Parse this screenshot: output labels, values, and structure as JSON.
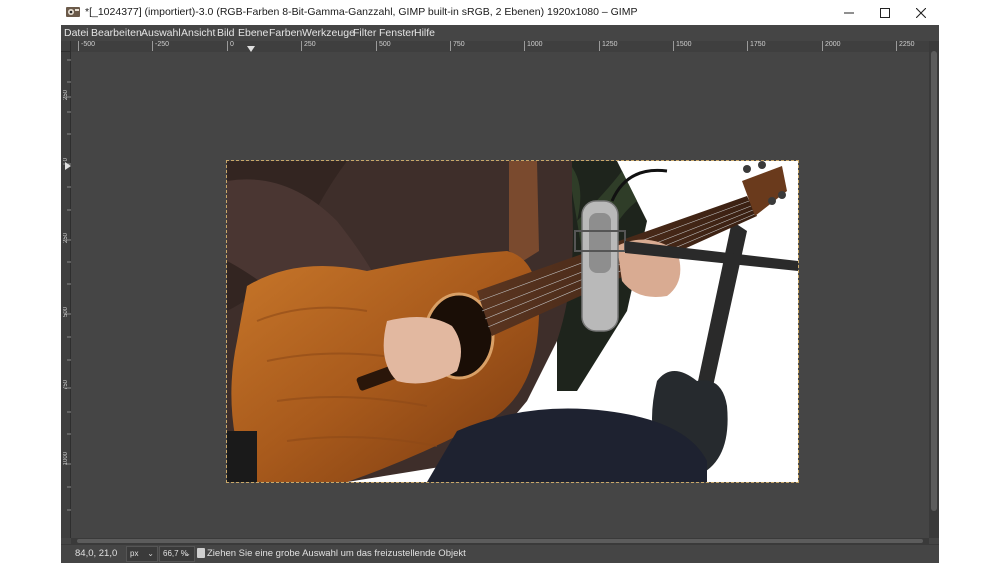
{
  "window": {
    "title": "*[_1024377] (importiert)-3.0 (RGB-Farben 8-Bit-Gamma-Ganzzahl, GIMP built-in sRGB, 2 Ebenen) 1920x1080 – GIMP",
    "controls": {
      "minimize": "—",
      "maximize": "☐",
      "close": "✕"
    }
  },
  "menu": [
    {
      "label": "Datei"
    },
    {
      "label": "Bearbeiten"
    },
    {
      "label": "Auswahl"
    },
    {
      "label": "Ansicht"
    },
    {
      "label": "Bild"
    },
    {
      "label": "Ebene"
    },
    {
      "label": "Farben"
    },
    {
      "label": "Werkzeuge"
    },
    {
      "label": "Filter"
    },
    {
      "label": "Fenster"
    },
    {
      "label": "Hilfe"
    }
  ],
  "ruler": {
    "horizontal": [
      "-500",
      "-250",
      "0",
      "250",
      "500",
      "750",
      "1000",
      "1250",
      "1500",
      "1750",
      "2000",
      "2250"
    ],
    "vertical": [
      "250",
      "0",
      "250",
      "500",
      "750",
      "1000"
    ]
  },
  "status": {
    "coords": "84,0, 21,0",
    "unit": "px",
    "zoom": "66,7 %",
    "message": "Ziehen Sie eine grobe Auswahl um das freizustellende Objekt"
  },
  "icons": {
    "app": "gimp-icon",
    "status": "info-icon",
    "navigate": "navigate-icon"
  },
  "colors": {
    "canvas_bg": "#454545",
    "titlebar_bg": "#ffffff",
    "selection_outline": "#c9a86a"
  }
}
